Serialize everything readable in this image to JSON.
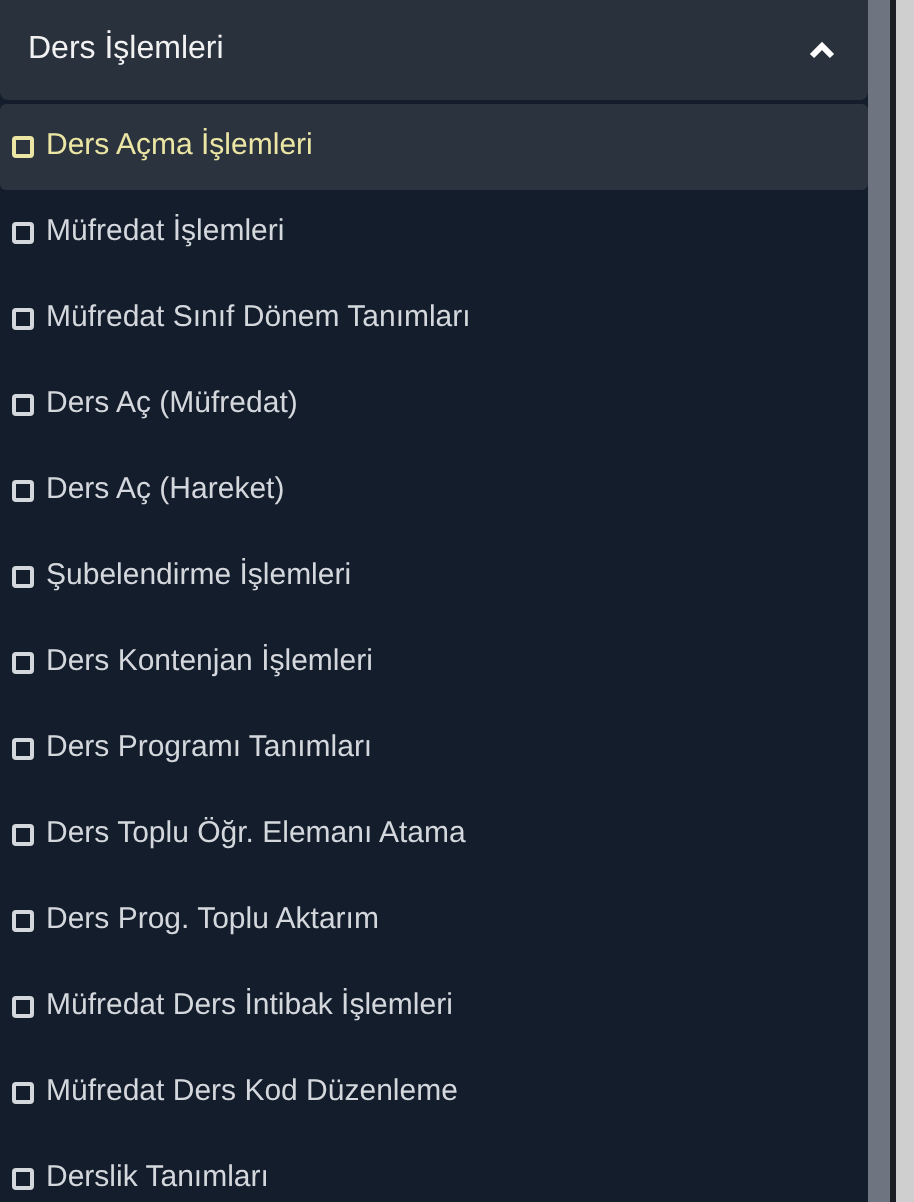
{
  "section": {
    "title": "Ders İşlemleri",
    "expanded": true
  },
  "items": [
    {
      "label": "Ders Açma İşlemleri",
      "selected": true
    },
    {
      "label": "Müfredat İşlemleri",
      "selected": false
    },
    {
      "label": "Müfredat Sınıf Dönem Tanımları",
      "selected": false
    },
    {
      "label": "Ders Aç (Müfredat)",
      "selected": false
    },
    {
      "label": "Ders Aç (Hareket)",
      "selected": false
    },
    {
      "label": "Şubelendirme İşlemleri",
      "selected": false
    },
    {
      "label": "Ders Kontenjan İşlemleri",
      "selected": false
    },
    {
      "label": "Ders Programı Tanımları",
      "selected": false
    },
    {
      "label": "Ders Toplu Öğr. Elemanı Atama",
      "selected": false
    },
    {
      "label": "Ders Prog. Toplu Aktarım",
      "selected": false
    },
    {
      "label": "Müfredat Ders İntibak İşlemleri",
      "selected": false
    },
    {
      "label": "Müfredat Ders Kod Düzenleme",
      "selected": false
    },
    {
      "label": "Derslik Tanımları",
      "selected": false
    }
  ]
}
